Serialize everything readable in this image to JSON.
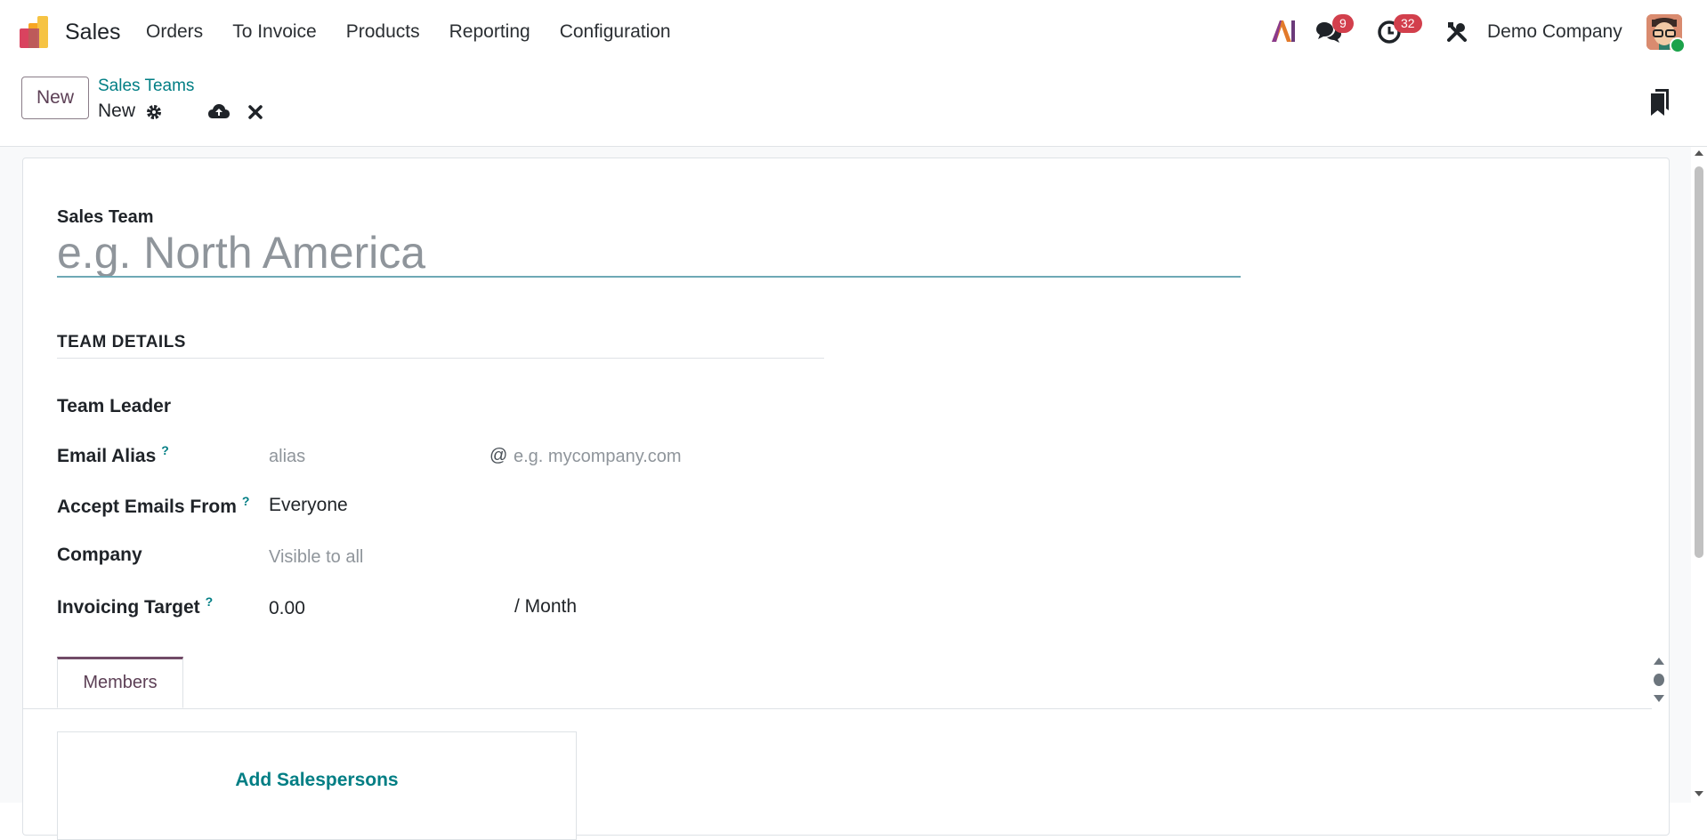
{
  "navbar": {
    "app_name": "Sales",
    "menu": [
      {
        "label": "Orders"
      },
      {
        "label": "To Invoice"
      },
      {
        "label": "Products"
      },
      {
        "label": "Reporting"
      },
      {
        "label": "Configuration"
      }
    ],
    "ai_icon": "ai-icon",
    "messages_badge": "9",
    "activities_badge": "32",
    "company": "Demo Company"
  },
  "control": {
    "new_label": "New",
    "breadcrumb_parent": "Sales Teams",
    "breadcrumb_current": "New"
  },
  "form": {
    "sales_team_label": "Sales Team",
    "name_placeholder": "e.g. North America",
    "section_title": "TEAM DETAILS",
    "team_leader_label": "Team Leader",
    "email_alias_label": "Email Alias",
    "alias_placeholder": "alias",
    "at_symbol": "@",
    "domain_placeholder": "e.g. mycompany.com",
    "accept_emails_label": "Accept Emails From",
    "accept_emails_value": "Everyone",
    "company_label": "Company",
    "company_placeholder": "Visible to all",
    "invoicing_target_label": "Invoicing Target",
    "invoicing_target_value": "0.00",
    "per_month": "/ Month",
    "help_mark": "?",
    "tab_members": "Members",
    "add_salespersons": "Add Salespersons"
  },
  "colors": {
    "brand": "#714b67",
    "link": "#017e84",
    "badge": "#d23f4c"
  }
}
